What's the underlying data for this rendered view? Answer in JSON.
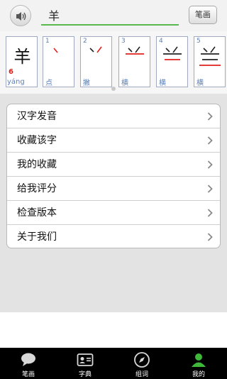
{
  "search": {
    "value": "羊",
    "button_label": "笔画"
  },
  "character": {
    "glyph": "羊",
    "stroke_count": "6",
    "pinyin": "yáng"
  },
  "strokes": [
    {
      "num": "1",
      "name": "点"
    },
    {
      "num": "2",
      "name": "撇"
    },
    {
      "num": "3",
      "name": "横"
    },
    {
      "num": "4",
      "name": "横"
    },
    {
      "num": "5",
      "name": "横"
    }
  ],
  "menu": [
    {
      "label": "汉字发音"
    },
    {
      "label": "收藏该字"
    },
    {
      "label": "我的收藏"
    },
    {
      "label": "给我评分"
    },
    {
      "label": "检查版本"
    },
    {
      "label": "关于我们"
    }
  ],
  "tabs": [
    {
      "label": "笔画",
      "icon": "speech-bubble-icon"
    },
    {
      "label": "字典",
      "icon": "id-card-icon"
    },
    {
      "label": "组词",
      "icon": "compass-icon"
    },
    {
      "label": "我的",
      "icon": "user-icon"
    }
  ],
  "colors": {
    "accent": "#59b84e",
    "stroke_highlight": "#e0201b",
    "link_blue": "#5a7fb6"
  }
}
